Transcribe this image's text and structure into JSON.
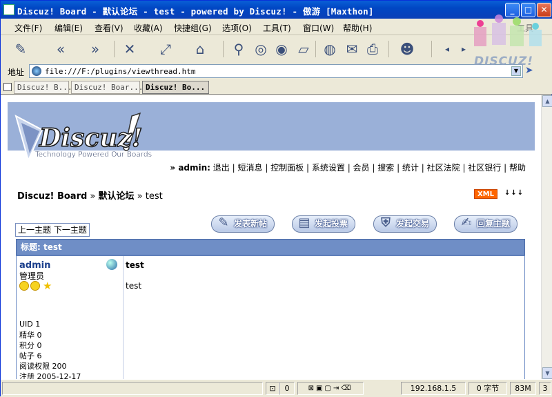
{
  "window": {
    "title": "Discuz! Board - 默认论坛 - test - powered by Discuz! - 傲游 [Maxthon]"
  },
  "menubar": {
    "items": [
      "文件(F)",
      "编辑(E)",
      "查看(V)",
      "收藏(A)",
      "快捷组(G)",
      "选项(O)",
      "工具(T)",
      "窗口(W)",
      "帮助(H)",
      "工具"
    ]
  },
  "address": {
    "label": "地址",
    "url": "file:///F:/plugins/viewthread.htm"
  },
  "tabs": [
    {
      "label": "Discuz! B...",
      "active": false
    },
    {
      "label": "Discuz! Boar...",
      "active": false
    },
    {
      "label": "Discuz! Bo...",
      "active": true
    }
  ],
  "page": {
    "logo_text": "Discuz!",
    "logo_tagline": "Technology Powered Our Boards",
    "toplinks": {
      "user_prefix": "» admin:",
      "links": [
        "退出",
        "短消息",
        "控制面板",
        "系统设置",
        "会员",
        "搜索",
        "统计",
        "社区法院",
        "社区银行",
        "帮助"
      ]
    },
    "breadcrumb": {
      "board": "Discuz! Board",
      "sep1": " » ",
      "forum": "默认论坛",
      "sep2": " » ",
      "thread": "test"
    },
    "xml_badge": "XML",
    "prevnext": {
      "prev": "上一主题",
      "next": "下一主题"
    },
    "action_buttons": [
      {
        "label": "发表新帖",
        "icon": "new-post-icon"
      },
      {
        "label": "发起投票",
        "icon": "poll-icon"
      },
      {
        "label": "发起交易",
        "icon": "trade-icon"
      },
      {
        "label": "回复主题",
        "icon": "reply-icon"
      }
    ],
    "post_header": "标题: test",
    "post": {
      "author": "admin",
      "role": "管理员",
      "stats": [
        "UID 1",
        "精华  0",
        "积分  0",
        "帖子  6",
        "阅读权限  200",
        "注册  2005-12-17"
      ],
      "title": "test",
      "body": "test"
    }
  },
  "statusbar": {
    "popup_count": "0",
    "ip": "192.168.1.5",
    "bytes": "0 字节",
    "memory": "83M",
    "tabs": "3"
  },
  "watermark": {
    "text": "DISCUZ!"
  }
}
